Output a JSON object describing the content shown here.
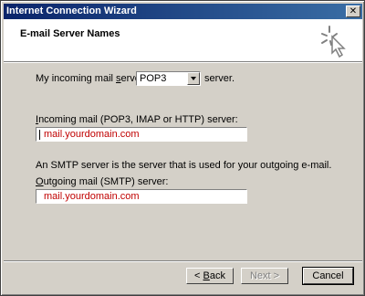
{
  "window": {
    "title": "Internet Connection Wizard",
    "close_glyph": "✕"
  },
  "header": {
    "title": "E-mail Server Names",
    "icon": "wizard-sparkle-cursor-icon"
  },
  "incoming_type": {
    "label_prefix": "My incoming mail ",
    "label_access": "s",
    "label_suffix": "erver is a",
    "value": "POP3",
    "after_label": "server."
  },
  "incoming": {
    "label_access": "I",
    "label_rest": "ncoming mail (POP3, IMAP or HTTP) server:",
    "value": "mail.yourdomain.com"
  },
  "smtp_note": "An SMTP server is the server that is used for your outgoing e-mail.",
  "outgoing": {
    "label_access": "O",
    "label_rest": "utgoing mail (SMTP) server:",
    "value": "mail.yourdomain.com"
  },
  "buttons": {
    "back_prefix": "< ",
    "back_access": "B",
    "back_rest": "ack",
    "next_label": "Next >",
    "cancel_label": "Cancel"
  },
  "colors": {
    "input_text": "#c00000",
    "title_gradient_start": "#0a246a",
    "title_gradient_end": "#3a6ea5"
  }
}
